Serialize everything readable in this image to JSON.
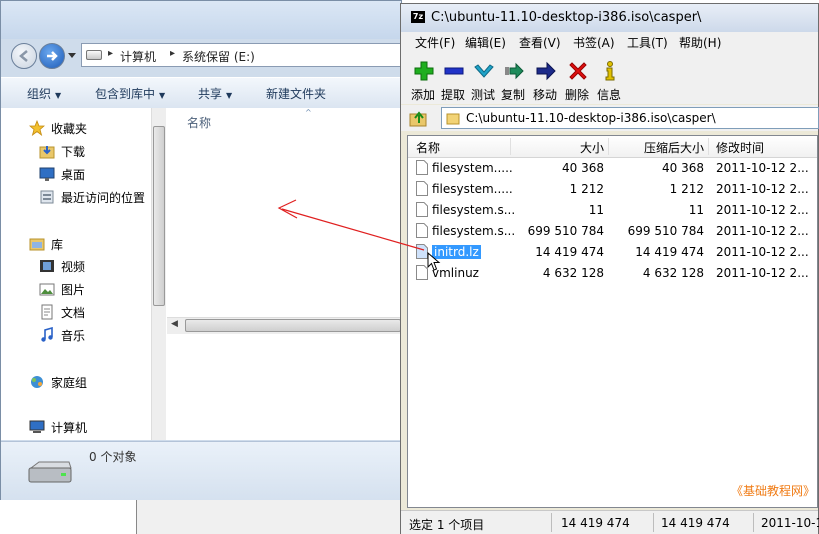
{
  "explorer": {
    "breadcrumbs": [
      "计算机",
      "系统保留 (E:)"
    ],
    "toolbar": [
      "组织",
      "包含到库中",
      "共享",
      "新建文件夹"
    ],
    "nav": {
      "favorites_header": "收藏夹",
      "favorites": [
        "下载",
        "桌面",
        "最近访问的位置"
      ],
      "libraries_header": "库",
      "libraries": [
        "视频",
        "图片",
        "文档",
        "音乐"
      ],
      "homegroup": "家庭组",
      "computer": "计算机"
    },
    "column_name": "名称",
    "details_text": "0 个对象"
  },
  "sevenzip": {
    "title": "C:\\ubuntu-11.10-desktop-i386.iso\\casper\\",
    "app_icon": "7z",
    "menu": [
      "文件(F)",
      "编辑(E)",
      "查看(V)",
      "书签(A)",
      "工具(T)",
      "帮助(H)"
    ],
    "tools": [
      {
        "label": "添加",
        "icon": "plus-icon",
        "color": "#1fae1f"
      },
      {
        "label": "提取",
        "icon": "minus-icon",
        "color": "#2033c8"
      },
      {
        "label": "测试",
        "icon": "check-icon",
        "color": "#1fa3c8"
      },
      {
        "label": "复制",
        "icon": "copy-arrow-icon",
        "color": "#1e8c5c"
      },
      {
        "label": "移动",
        "icon": "move-arrow-icon",
        "color": "#1c2a8a"
      },
      {
        "label": "删除",
        "icon": "delete-x-icon",
        "color": "#e01010"
      },
      {
        "label": "信息",
        "icon": "info-icon",
        "color": "#e0c000"
      }
    ],
    "path": "C:\\ubuntu-11.10-desktop-i386.iso\\casper\\",
    "columns": [
      "名称",
      "大小",
      "压缩后大小",
      "修改时间"
    ],
    "files": [
      {
        "name": "filesystem.....",
        "size": "40 368",
        "packed": "40 368",
        "modified": "2011-10-12 2..."
      },
      {
        "name": "filesystem.....",
        "size": "1 212",
        "packed": "1 212",
        "modified": "2011-10-12 2..."
      },
      {
        "name": "filesystem.s...",
        "size": "11",
        "packed": "11",
        "modified": "2011-10-12 2..."
      },
      {
        "name": "filesystem.s...",
        "size": "699 510 784",
        "packed": "699 510 784",
        "modified": "2011-10-12 2..."
      },
      {
        "name": "initrd.lz",
        "size": "14 419 474",
        "packed": "14 419 474",
        "modified": "2011-10-12 2...",
        "selected": true
      },
      {
        "name": "vmlinuz",
        "size": "4 632 128",
        "packed": "4 632 128",
        "modified": "2011-10-12 2..."
      }
    ],
    "status": {
      "selection": "选定 1 个项目",
      "size": "14 419 474",
      "packed": "14 419 474",
      "modified": "2011-10-1..."
    },
    "watermark": "《基础教程网》"
  },
  "colors": {
    "selection": "#3399ff",
    "drag_arrow": "#e02020",
    "watermark": "#f07b14"
  }
}
